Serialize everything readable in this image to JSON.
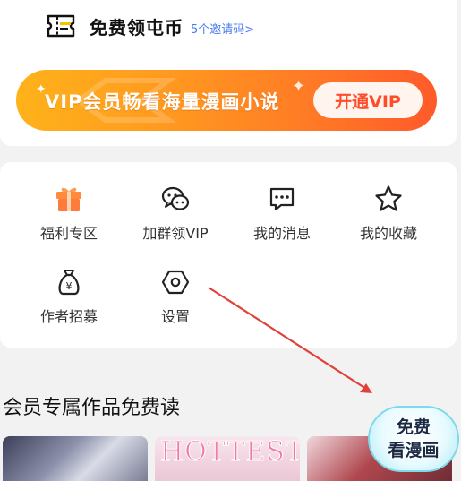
{
  "coins": {
    "title": "免费领屯币",
    "subtitle": "5个邀请码>"
  },
  "vip_banner": {
    "text": "VIP会员畅看海量漫画小说",
    "button": "开通VIP"
  },
  "menu": [
    {
      "label": "福利专区",
      "icon": "gift-icon"
    },
    {
      "label": "加群领VIP",
      "icon": "wechat-icon"
    },
    {
      "label": "我的消息",
      "icon": "message-icon"
    },
    {
      "label": "我的收藏",
      "icon": "star-icon"
    },
    {
      "label": "作者招募",
      "icon": "money-bag-icon"
    },
    {
      "label": "设置",
      "icon": "settings-icon"
    }
  ],
  "section": {
    "title": "会员专属作品免费读"
  },
  "thumbnails": [
    {
      "cover_text": ""
    },
    {
      "cover_text": "HOTTEST"
    },
    {
      "cover_text": ""
    }
  ],
  "float_badge": {
    "line1": "免费",
    "line2": "看漫画"
  },
  "colors": {
    "accent": "#ff7a26",
    "link": "#4a7cf0",
    "gift": "#ff7a3d",
    "annotation_arrow": "#e0413a"
  }
}
